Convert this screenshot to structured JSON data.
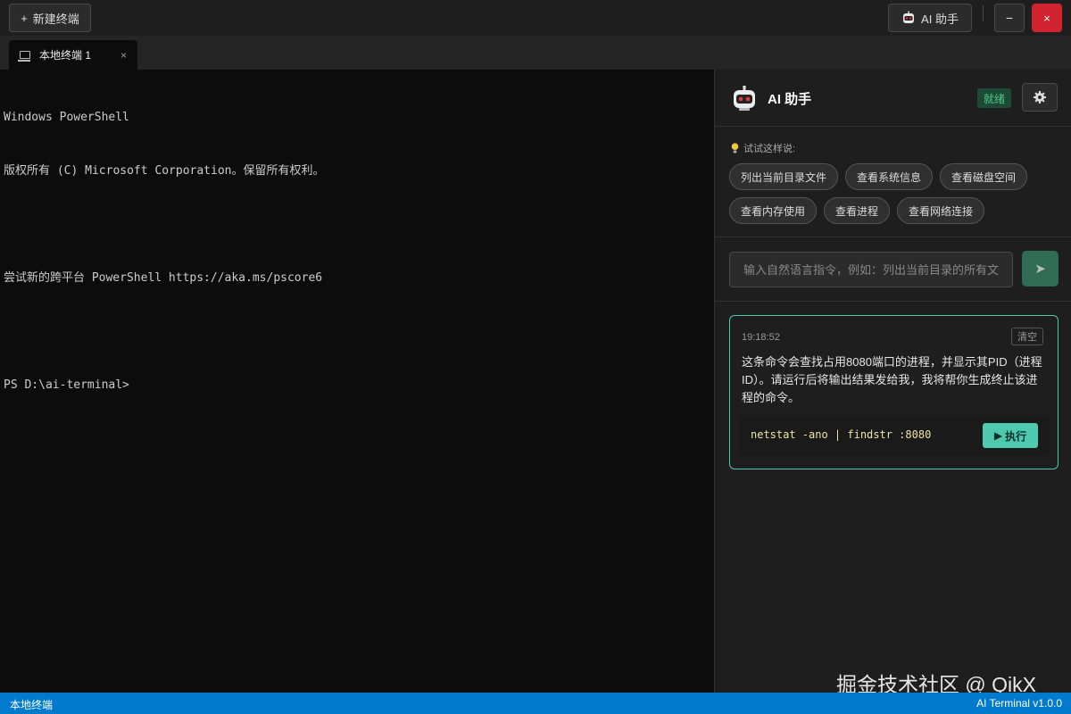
{
  "toolbar": {
    "new_terminal": "新建终端",
    "ai_button": "AI 助手",
    "minimize": "−",
    "close": "×"
  },
  "tabs": [
    {
      "label": "本地终端 1",
      "close": "×"
    }
  ],
  "terminal": {
    "lines": [
      "Windows PowerShell",
      "版权所有 (C) Microsoft Corporation。保留所有权利。",
      "",
      "尝试新的跨平台 PowerShell https://aka.ms/pscore6",
      "",
      "PS D:\\ai-terminal>"
    ]
  },
  "assistant": {
    "title": "AI 助手",
    "status": "就绪",
    "suggest_label": "试试这样说:",
    "suggestions": [
      "列出当前目录文件",
      "查看系统信息",
      "查看磁盘空间",
      "查看内存使用",
      "查看进程",
      "查看网络连接"
    ],
    "input_placeholder": "输入自然语言指令，例如：列出当前目录的所有文件",
    "card": {
      "time": "19:18:52",
      "clear": "清空",
      "text": "这条命令会查找占用8080端口的进程，并显示其PID（进程ID）。请运行后将输出结果发给我，我将帮你生成终止该进程的命令。",
      "command": "netstat -ano | findstr :8080",
      "execute": "执行"
    }
  },
  "watermark": "掘金技术社区 @ QikX",
  "statusbar": {
    "left": "本地终端",
    "right": "AI Terminal v1.0.0"
  },
  "colors": {
    "accent": "#4ec9b0",
    "statusbar": "#007acc",
    "close_button": "#d1232f",
    "ready_badge": "#4ec98b"
  }
}
